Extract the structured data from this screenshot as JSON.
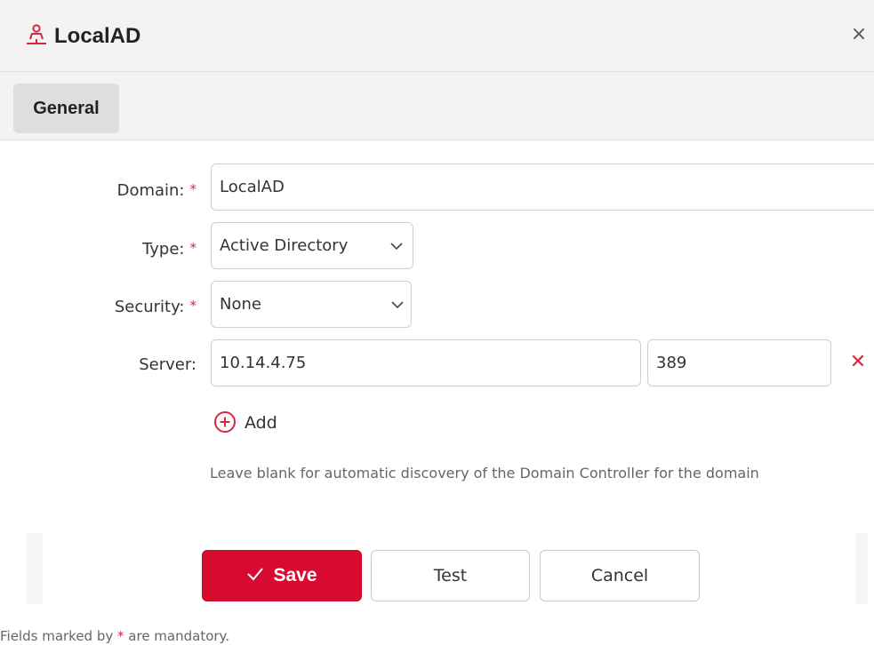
{
  "header": {
    "title": "LocalAD",
    "app_icon": "network-user-icon",
    "close_label": "×",
    "accent_color": "#d9263f"
  },
  "tabs": [
    {
      "label": "General",
      "active": true
    }
  ],
  "form": {
    "required_marker": "*",
    "domain": {
      "label": "Domain:",
      "value": "LocalAD"
    },
    "type": {
      "label": "Type:",
      "value": "Active Directory"
    },
    "security": {
      "label": "Security:",
      "value": "None"
    },
    "server": {
      "label": "Server:",
      "host": "10.14.4.75",
      "port": "389",
      "remove_label": "✕"
    },
    "add_label": "Add",
    "help_text": "Leave blank for automatic discovery of the Domain Controller for the domain"
  },
  "buttons": {
    "save_label": "Save",
    "test_label": "Test",
    "cancel_label": "Cancel",
    "primary_color": "#d70a30"
  },
  "footer": {
    "prefix": "Fields marked by ",
    "star": "*",
    "suffix": " are mandatory."
  }
}
